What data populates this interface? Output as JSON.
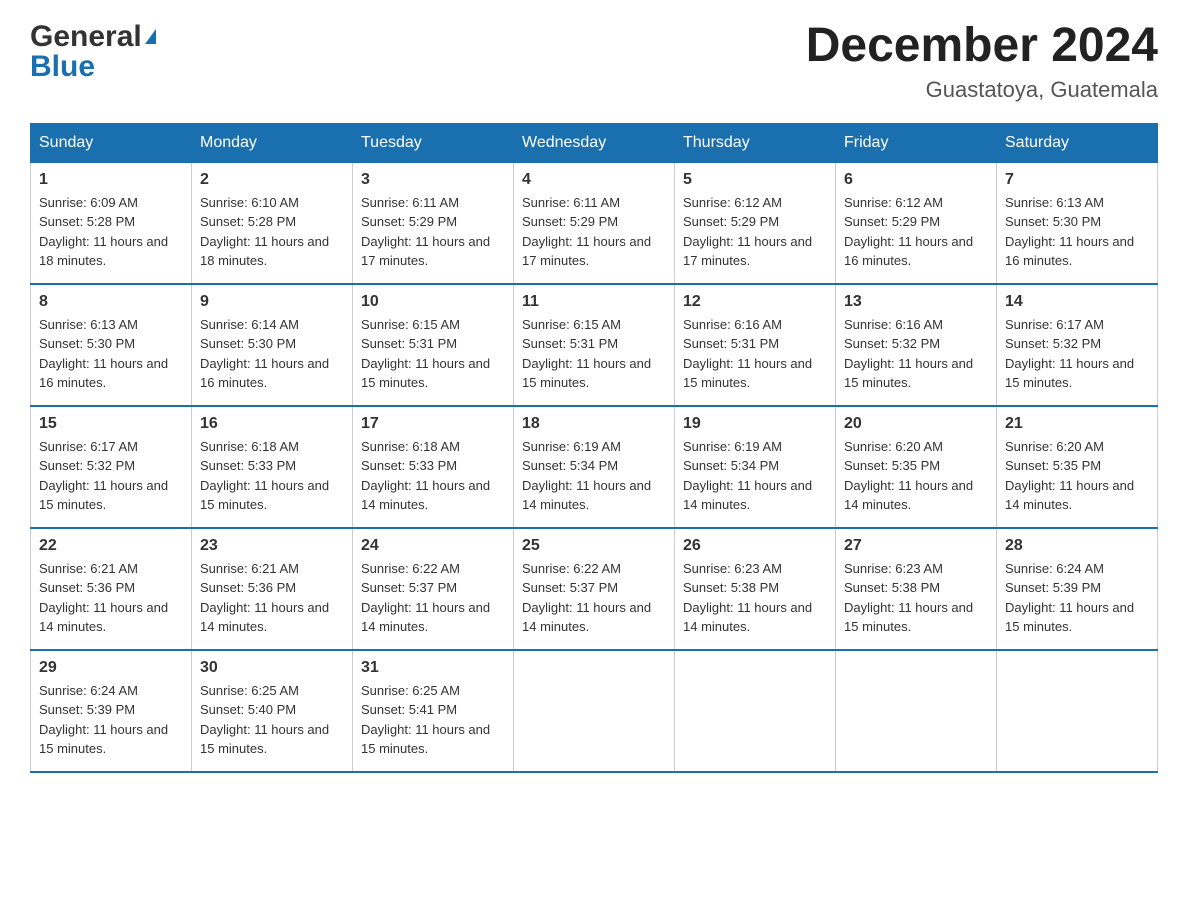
{
  "logo": {
    "general": "General",
    "blue": "Blue",
    "triangle": "▲"
  },
  "title": {
    "month_year": "December 2024",
    "location": "Guastatoya, Guatemala"
  },
  "weekdays": [
    "Sunday",
    "Monday",
    "Tuesday",
    "Wednesday",
    "Thursday",
    "Friday",
    "Saturday"
  ],
  "weeks": [
    [
      {
        "day": "1",
        "sunrise": "6:09 AM",
        "sunset": "5:28 PM",
        "daylight": "11 hours and 18 minutes."
      },
      {
        "day": "2",
        "sunrise": "6:10 AM",
        "sunset": "5:28 PM",
        "daylight": "11 hours and 18 minutes."
      },
      {
        "day": "3",
        "sunrise": "6:11 AM",
        "sunset": "5:29 PM",
        "daylight": "11 hours and 17 minutes."
      },
      {
        "day": "4",
        "sunrise": "6:11 AM",
        "sunset": "5:29 PM",
        "daylight": "11 hours and 17 minutes."
      },
      {
        "day": "5",
        "sunrise": "6:12 AM",
        "sunset": "5:29 PM",
        "daylight": "11 hours and 17 minutes."
      },
      {
        "day": "6",
        "sunrise": "6:12 AM",
        "sunset": "5:29 PM",
        "daylight": "11 hours and 16 minutes."
      },
      {
        "day": "7",
        "sunrise": "6:13 AM",
        "sunset": "5:30 PM",
        "daylight": "11 hours and 16 minutes."
      }
    ],
    [
      {
        "day": "8",
        "sunrise": "6:13 AM",
        "sunset": "5:30 PM",
        "daylight": "11 hours and 16 minutes."
      },
      {
        "day": "9",
        "sunrise": "6:14 AM",
        "sunset": "5:30 PM",
        "daylight": "11 hours and 16 minutes."
      },
      {
        "day": "10",
        "sunrise": "6:15 AM",
        "sunset": "5:31 PM",
        "daylight": "11 hours and 15 minutes."
      },
      {
        "day": "11",
        "sunrise": "6:15 AM",
        "sunset": "5:31 PM",
        "daylight": "11 hours and 15 minutes."
      },
      {
        "day": "12",
        "sunrise": "6:16 AM",
        "sunset": "5:31 PM",
        "daylight": "11 hours and 15 minutes."
      },
      {
        "day": "13",
        "sunrise": "6:16 AM",
        "sunset": "5:32 PM",
        "daylight": "11 hours and 15 minutes."
      },
      {
        "day": "14",
        "sunrise": "6:17 AM",
        "sunset": "5:32 PM",
        "daylight": "11 hours and 15 minutes."
      }
    ],
    [
      {
        "day": "15",
        "sunrise": "6:17 AM",
        "sunset": "5:32 PM",
        "daylight": "11 hours and 15 minutes."
      },
      {
        "day": "16",
        "sunrise": "6:18 AM",
        "sunset": "5:33 PM",
        "daylight": "11 hours and 15 minutes."
      },
      {
        "day": "17",
        "sunrise": "6:18 AM",
        "sunset": "5:33 PM",
        "daylight": "11 hours and 14 minutes."
      },
      {
        "day": "18",
        "sunrise": "6:19 AM",
        "sunset": "5:34 PM",
        "daylight": "11 hours and 14 minutes."
      },
      {
        "day": "19",
        "sunrise": "6:19 AM",
        "sunset": "5:34 PM",
        "daylight": "11 hours and 14 minutes."
      },
      {
        "day": "20",
        "sunrise": "6:20 AM",
        "sunset": "5:35 PM",
        "daylight": "11 hours and 14 minutes."
      },
      {
        "day": "21",
        "sunrise": "6:20 AM",
        "sunset": "5:35 PM",
        "daylight": "11 hours and 14 minutes."
      }
    ],
    [
      {
        "day": "22",
        "sunrise": "6:21 AM",
        "sunset": "5:36 PM",
        "daylight": "11 hours and 14 minutes."
      },
      {
        "day": "23",
        "sunrise": "6:21 AM",
        "sunset": "5:36 PM",
        "daylight": "11 hours and 14 minutes."
      },
      {
        "day": "24",
        "sunrise": "6:22 AM",
        "sunset": "5:37 PM",
        "daylight": "11 hours and 14 minutes."
      },
      {
        "day": "25",
        "sunrise": "6:22 AM",
        "sunset": "5:37 PM",
        "daylight": "11 hours and 14 minutes."
      },
      {
        "day": "26",
        "sunrise": "6:23 AM",
        "sunset": "5:38 PM",
        "daylight": "11 hours and 14 minutes."
      },
      {
        "day": "27",
        "sunrise": "6:23 AM",
        "sunset": "5:38 PM",
        "daylight": "11 hours and 15 minutes."
      },
      {
        "day": "28",
        "sunrise": "6:24 AM",
        "sunset": "5:39 PM",
        "daylight": "11 hours and 15 minutes."
      }
    ],
    [
      {
        "day": "29",
        "sunrise": "6:24 AM",
        "sunset": "5:39 PM",
        "daylight": "11 hours and 15 minutes."
      },
      {
        "day": "30",
        "sunrise": "6:25 AM",
        "sunset": "5:40 PM",
        "daylight": "11 hours and 15 minutes."
      },
      {
        "day": "31",
        "sunrise": "6:25 AM",
        "sunset": "5:41 PM",
        "daylight": "11 hours and 15 minutes."
      },
      null,
      null,
      null,
      null
    ]
  ]
}
